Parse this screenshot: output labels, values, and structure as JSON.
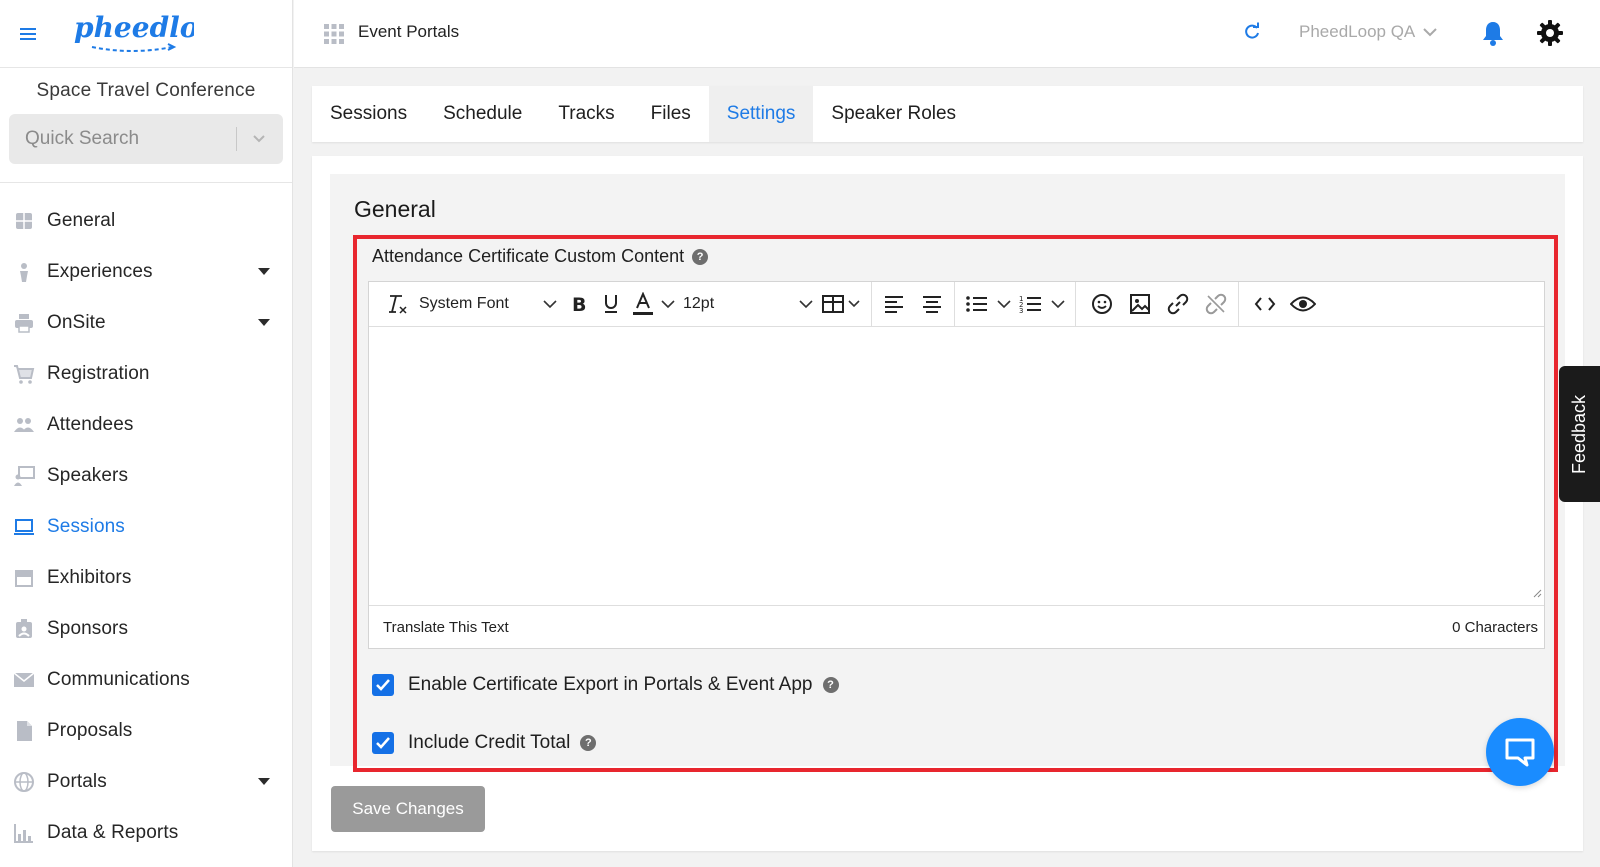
{
  "app": {
    "logo_text": "pheedloop",
    "event_name": "Space Travel Conference"
  },
  "sidebar": {
    "search_placeholder": "Quick Search",
    "items": [
      {
        "label": "General",
        "icon": "grid-icon",
        "has_submenu": false,
        "active": false
      },
      {
        "label": "Experiences",
        "icon": "person-icon",
        "has_submenu": true,
        "active": false
      },
      {
        "label": "OnSite",
        "icon": "printer-icon",
        "has_submenu": true,
        "active": false
      },
      {
        "label": "Registration",
        "icon": "cart-icon",
        "has_submenu": false,
        "active": false
      },
      {
        "label": "Attendees",
        "icon": "people-icon",
        "has_submenu": false,
        "active": false
      },
      {
        "label": "Speakers",
        "icon": "presenter-icon",
        "has_submenu": false,
        "active": false
      },
      {
        "label": "Sessions",
        "icon": "laptop-icon",
        "has_submenu": false,
        "active": true
      },
      {
        "label": "Exhibitors",
        "icon": "storefront-icon",
        "has_submenu": false,
        "active": false
      },
      {
        "label": "Sponsors",
        "icon": "badge-icon",
        "has_submenu": false,
        "active": false
      },
      {
        "label": "Communications",
        "icon": "envelope-icon",
        "has_submenu": false,
        "active": false
      },
      {
        "label": "Proposals",
        "icon": "document-icon",
        "has_submenu": false,
        "active": false
      },
      {
        "label": "Portals",
        "icon": "globe-icon",
        "has_submenu": true,
        "active": false
      },
      {
        "label": "Data & Reports",
        "icon": "bar-chart-icon",
        "has_submenu": false,
        "active": false
      }
    ]
  },
  "topbar": {
    "title": "Event Portals",
    "account": "PheedLoop QA"
  },
  "tabs": [
    {
      "label": "Sessions",
      "active": false
    },
    {
      "label": "Schedule",
      "active": false
    },
    {
      "label": "Tracks",
      "active": false
    },
    {
      "label": "Files",
      "active": false
    },
    {
      "label": "Settings",
      "active": true
    },
    {
      "label": "Speaker Roles",
      "active": false
    }
  ],
  "settings": {
    "section_title": "General",
    "certificate_label": "Attendance Certificate Custom Content",
    "editor": {
      "font_family": "System Font",
      "font_size": "12pt",
      "content": "",
      "translate_label": "Translate This Text",
      "character_count": "0 Characters"
    },
    "options": [
      {
        "label": "Enable Certificate Export in Portals & Event App",
        "checked": true
      },
      {
        "label": "Include Credit Total",
        "checked": true
      }
    ],
    "save_label": "Save Changes"
  },
  "feedback_label": "Feedback",
  "colors": {
    "accent": "#1e7be6",
    "highlight_border": "#e8262e",
    "checkbox": "#1470e6",
    "chat_button": "#1a8cff",
    "save_button": "#9a9a9a"
  }
}
